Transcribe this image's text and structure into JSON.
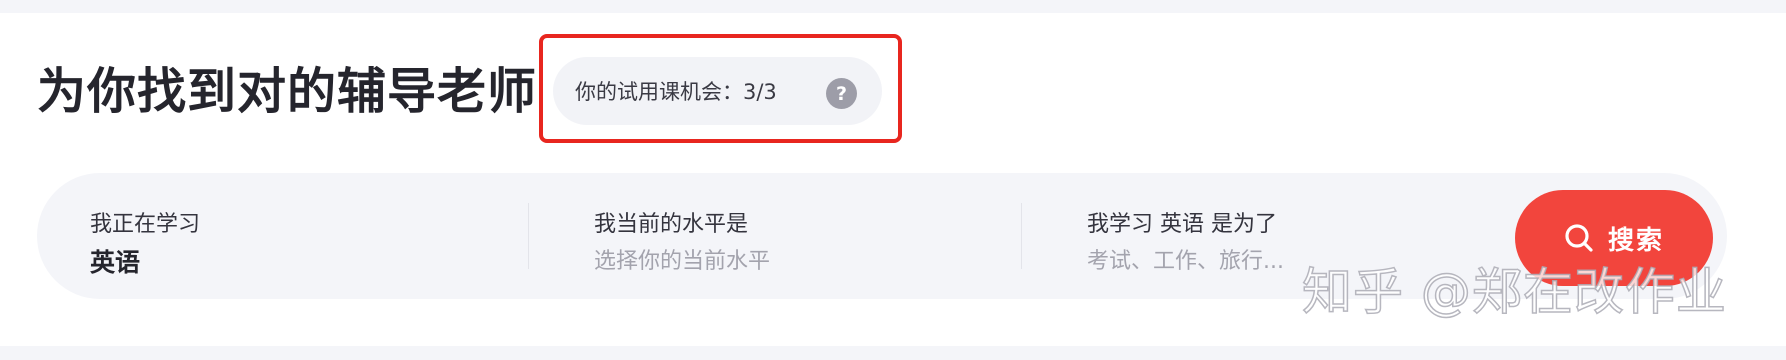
{
  "header": {
    "title": "为你找到对的辅导老师",
    "trial": {
      "label": "你的试用课机会：3/3",
      "help_icon": "question-mark-icon",
      "help_glyph": "?"
    }
  },
  "search": {
    "fields": [
      {
        "label": "我正在学习",
        "value": "英语"
      },
      {
        "label": "我当前的水平是",
        "placeholder": "选择你的当前水平"
      },
      {
        "label": "我学习 英语 是为了",
        "placeholder": "考试、工作、旅行..."
      }
    ],
    "button": {
      "icon": "search-icon",
      "label": "搜索"
    }
  },
  "watermark": {
    "text": "知乎 @郑在改作业"
  },
  "colors": {
    "accent": "#f2453d",
    "highlight_border": "#e8261f",
    "chip_background": "#f2f3f7",
    "search_bar_background": "#f4f5f9",
    "title_text": "#25252d",
    "placeholder_text": "#a3a3ad"
  }
}
